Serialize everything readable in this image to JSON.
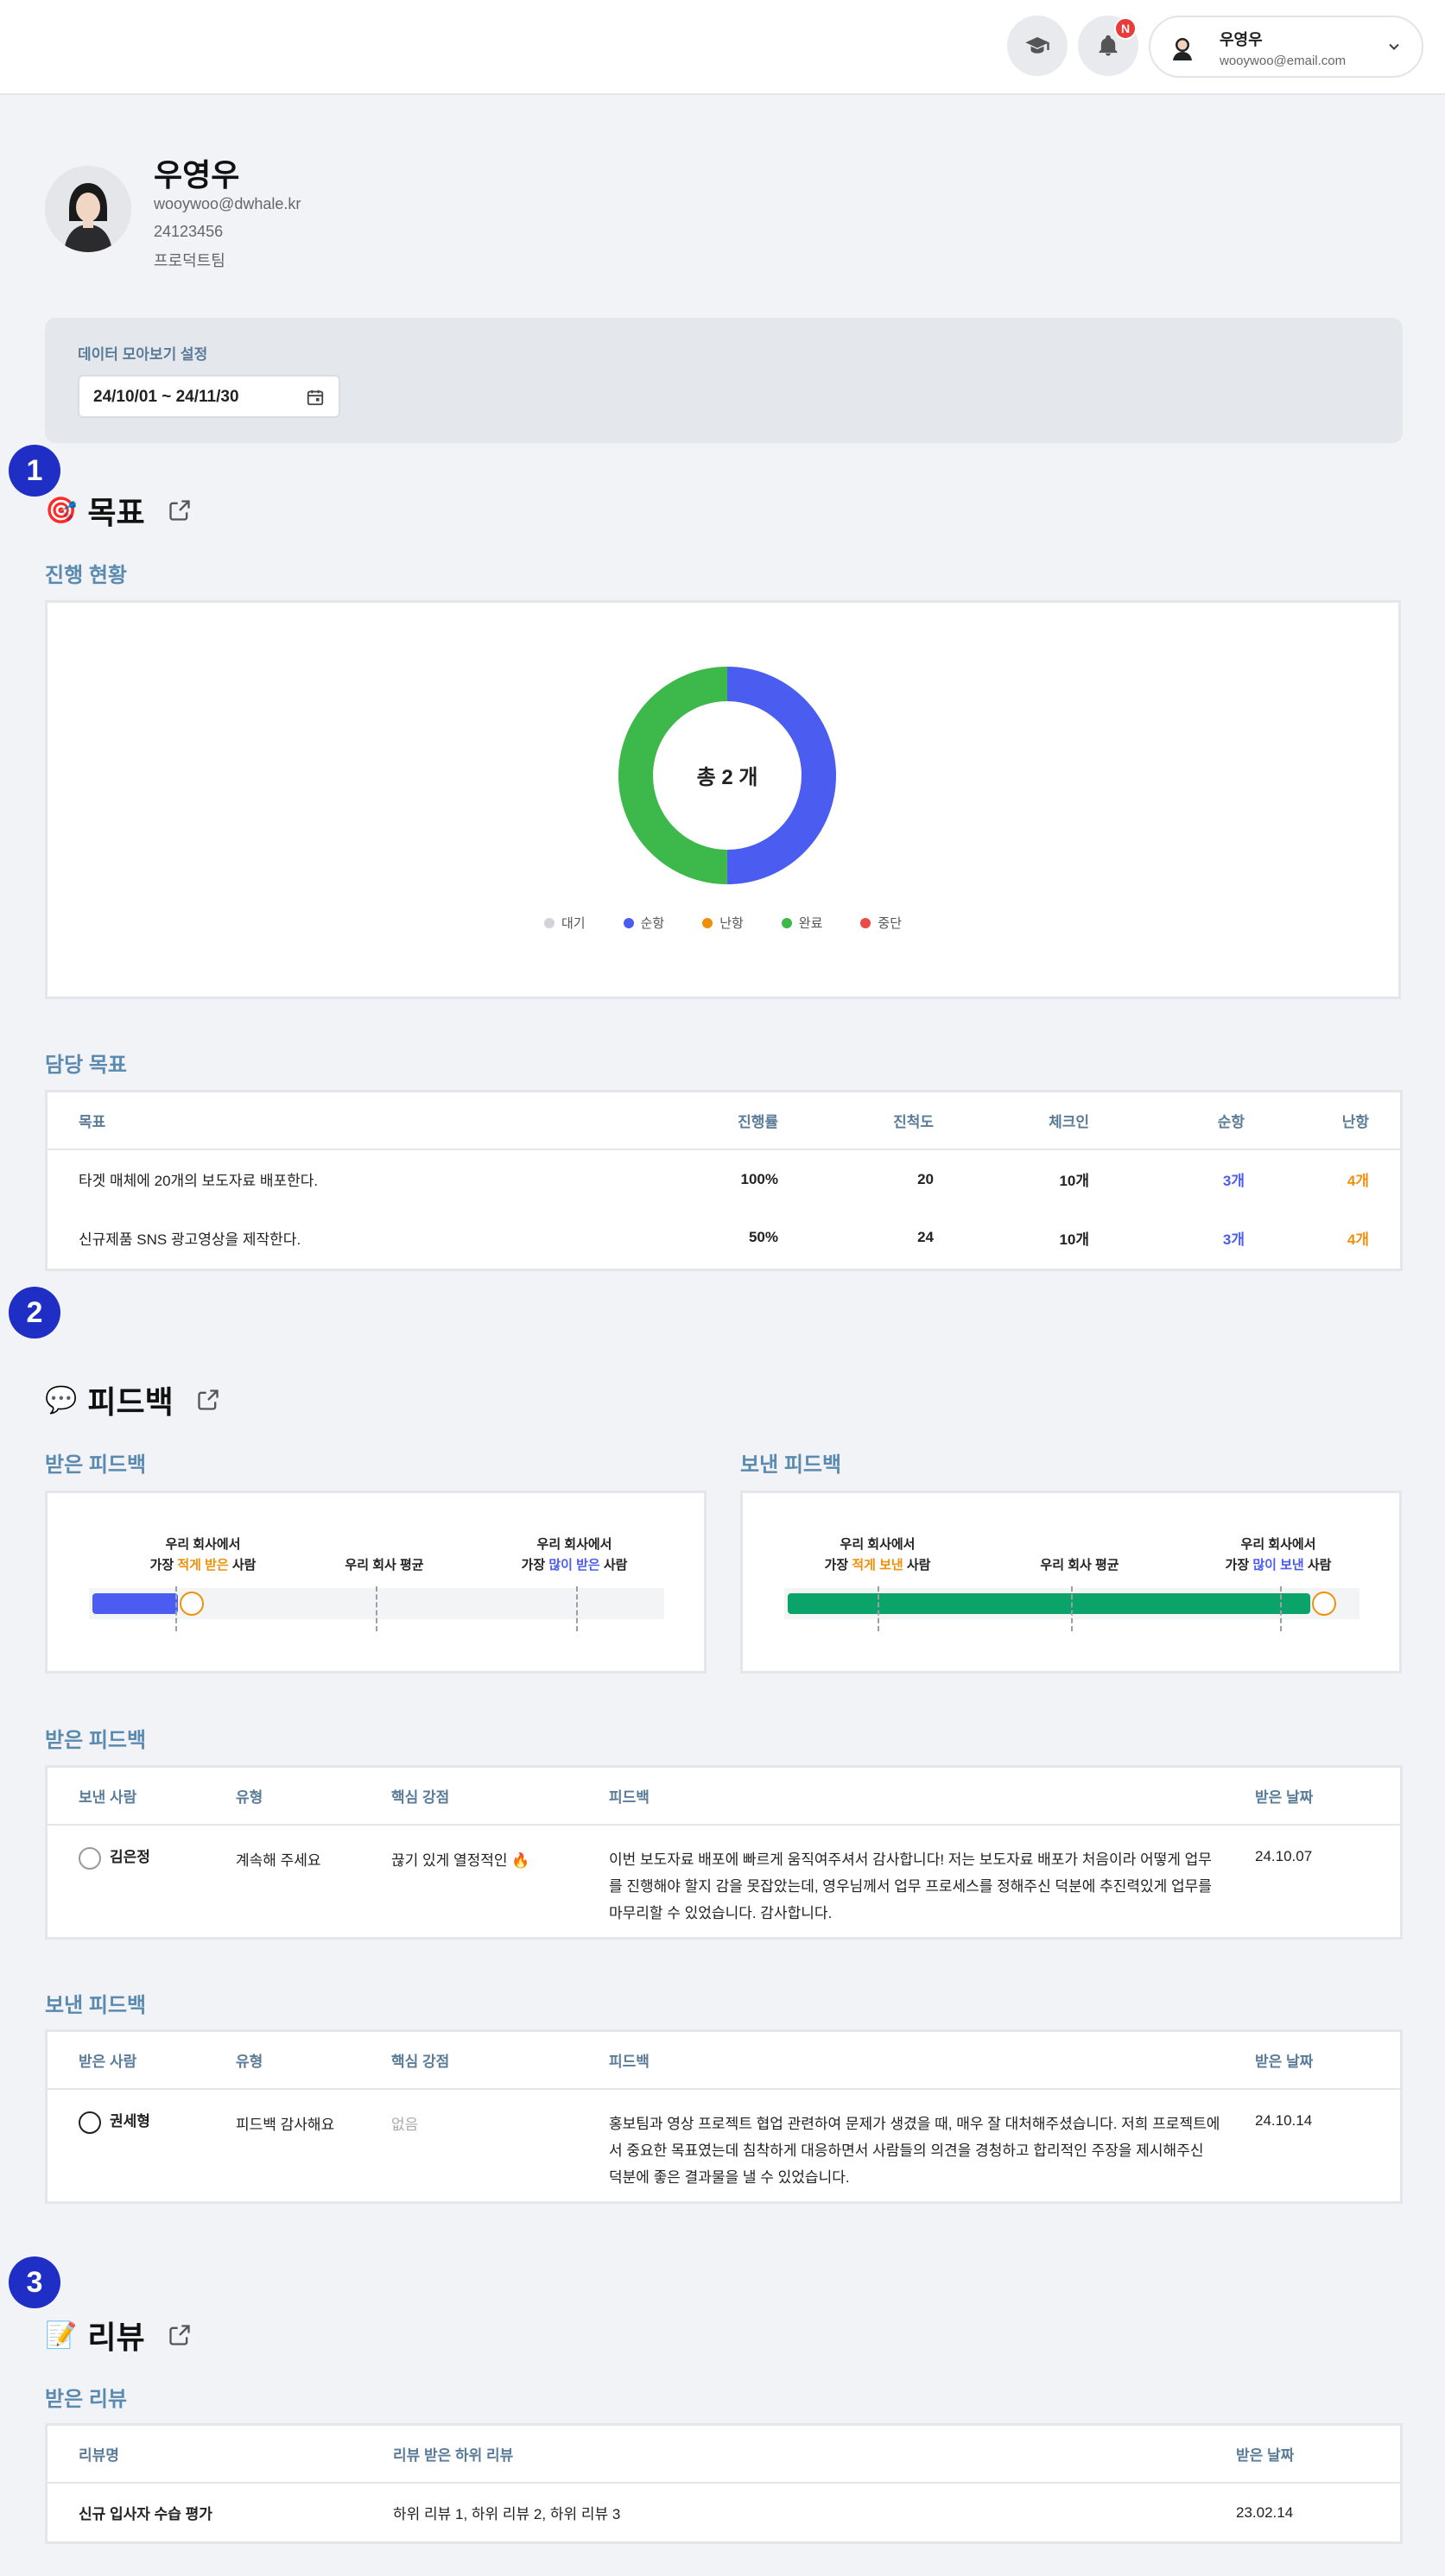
{
  "header": {
    "notification_badge": "N",
    "user_name": "우영우",
    "user_email": "wooywoo@email.com"
  },
  "profile": {
    "name": "우영우",
    "email": "wooywoo@dwhale.kr",
    "id": "24123456",
    "team": "프로덕트팀"
  },
  "settings": {
    "label": "데이터 모아보기 설정",
    "date_range": "24/10/01 ~ 24/11/30"
  },
  "badges": [
    "1",
    "2",
    "3"
  ],
  "goals": {
    "emoji": "🎯",
    "title": "목표",
    "progress_heading": "진행 현황",
    "donut_center": "총 2 개",
    "legend": [
      {
        "label": "대기",
        "color": "#d0d3d8"
      },
      {
        "label": "순항",
        "color": "#4b5cf0"
      },
      {
        "label": "난항",
        "color": "#f0900a"
      },
      {
        "label": "완료",
        "color": "#3db94b"
      },
      {
        "label": "중단",
        "color": "#ea4a4a"
      }
    ],
    "chart_data": {
      "type": "pie",
      "categories": [
        "대기",
        "순항",
        "난항",
        "완료",
        "중단"
      ],
      "values": [
        0,
        1,
        0,
        1,
        0
      ]
    },
    "assigned_heading": "담당 목표",
    "table": {
      "headers": [
        "목표",
        "진행률",
        "진척도",
        "체크인",
        "순항",
        "난항"
      ],
      "rows": [
        [
          "타겟 매체에 20개의 보도자료 배포한다.",
          "100%",
          "20",
          "10개",
          "3개",
          "4개"
        ],
        [
          "신규제품 SNS 광고영상을 제작한다.",
          "50%",
          "24",
          "10개",
          "3개",
          "4개"
        ]
      ]
    }
  },
  "feedback": {
    "emoji": "💬",
    "title": "피드백",
    "received_heading": "받은 피드백",
    "sent_heading": "보낸 피드백",
    "received_chart": {
      "label_left_1": "우리 회사에서",
      "label_left_2a": "가장 ",
      "label_left_2b": "적게 받은",
      "label_left_2c": " 사람",
      "label_mid": "우리 회사 평균",
      "label_right_1": "우리 회사에서",
      "label_right_2a": "가장 ",
      "label_right_2b": "많이 받은",
      "label_right_2c": " 사람",
      "fill_fraction": 0.15,
      "color": "#4b5cf0"
    },
    "sent_chart": {
      "label_left_1": "우리 회사에서",
      "label_left_2a": "가장 ",
      "label_left_2b": "적게 보낸",
      "label_left_2c": " 사람",
      "label_mid": "우리 회사 평균",
      "label_right_1": "우리 회사에서",
      "label_right_2a": "가장 ",
      "label_right_2b": "많이 보낸",
      "label_right_2c": " 사람",
      "fill_fraction": 0.92,
      "color": "#0aa36a"
    },
    "received_table_heading": "받은 피드백",
    "received_table": {
      "headers": [
        "보낸 사람",
        "유형",
        "핵심 강점",
        "피드백",
        "받은 날짜"
      ],
      "rows": [
        [
          "김은정",
          "계속해 주세요",
          "끊기 있게 열정적인 🔥",
          "이번 보도자료 배포에 빠르게 움직여주셔서 감사합니다! 저는 보도자료 배포가 처음이라 어떻게 업무를 진행해야 할지 감을 못잡았는데, 영우님께서 업무 프로세스를 정해주신 덕분에 추진력있게 업무를 마무리할 수 있었습니다. 감사합니다.",
          "24.10.07"
        ]
      ]
    },
    "sent_table_heading": "보낸 피드백",
    "sent_table": {
      "headers": [
        "받은 사람",
        "유형",
        "핵심 강점",
        "피드백",
        "받은 날짜"
      ],
      "rows": [
        [
          "권세형",
          "피드백 감사해요",
          "없음",
          "홍보팀과 영상 프로젝트 협업 관련하여 문제가 생겼을 때, 매우 잘 대처해주셨습니다. 저희 프로젝트에서 중요한 목표였는데 침착하게 대응하면서 사람들의 의견을 경청하고 합리적인 주장을 제시해주신 덕분에 좋은 결과물을 낼 수 있었습니다.",
          "24.10.14"
        ]
      ]
    }
  },
  "review": {
    "emoji": "📝",
    "title": "리뷰",
    "received_heading": "받은 리뷰",
    "table": {
      "headers": [
        "리뷰명",
        "리뷰 받은 하위 리뷰",
        "받은 날짜"
      ],
      "rows": [
        [
          "신규 입사자 수습 평가",
          "하위 리뷰 1, 하위 리뷰 2, 하위 리뷰 3",
          "23.02.14"
        ]
      ]
    }
  }
}
